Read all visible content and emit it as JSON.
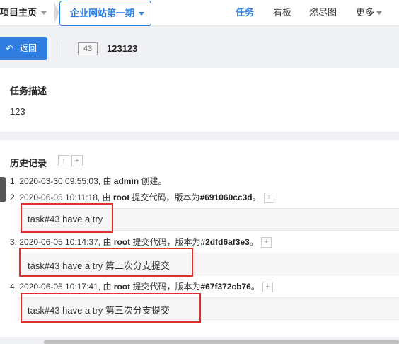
{
  "header": {
    "home_label": "项目主页",
    "project_label": "企业网站第一期",
    "nav": [
      {
        "label": "任务",
        "active": true
      },
      {
        "label": "看板",
        "active": false
      },
      {
        "label": "燃尽图",
        "active": false
      },
      {
        "label": "更多",
        "active": false
      }
    ]
  },
  "toolbar": {
    "back_icon": "undo-icon",
    "back_label": "返回",
    "task_id": "43",
    "task_title": "123123"
  },
  "description": {
    "title": "任务描述",
    "text": "123"
  },
  "history": {
    "title": "历史记录",
    "tool_icons": [
      "arrow-up-icon",
      "plus-icon"
    ],
    "items": [
      {
        "prefix": "1. 2020-03-30 09:55:03, 由 ",
        "user": "admin",
        "action": " 创建。",
        "comment": ""
      },
      {
        "prefix": "2. 2020-06-05 10:11:18, 由 ",
        "user": "root",
        "action": " 提交代码，版本为",
        "revision": "#691060cc3d",
        "suffix": "。",
        "comment": "task#43 have a try"
      },
      {
        "prefix": "3. 2020-06-05 10:14:37, 由 ",
        "user": "root",
        "action": " 提交代码，版本为",
        "revision": "#2dfd6af3e3",
        "suffix": "。",
        "comment": "task#43 have a try 第二次分支提交"
      },
      {
        "prefix": "4. 2020-06-05 10:17:41, 由 ",
        "user": "root",
        "action": " 提交代码，版本为",
        "revision": "#67f372cb76",
        "suffix": "。",
        "comment": "task#43 have a try 第三次分支提交"
      }
    ]
  },
  "colors": {
    "accent": "#2f7de1",
    "highlight_box": "#e0302a"
  }
}
